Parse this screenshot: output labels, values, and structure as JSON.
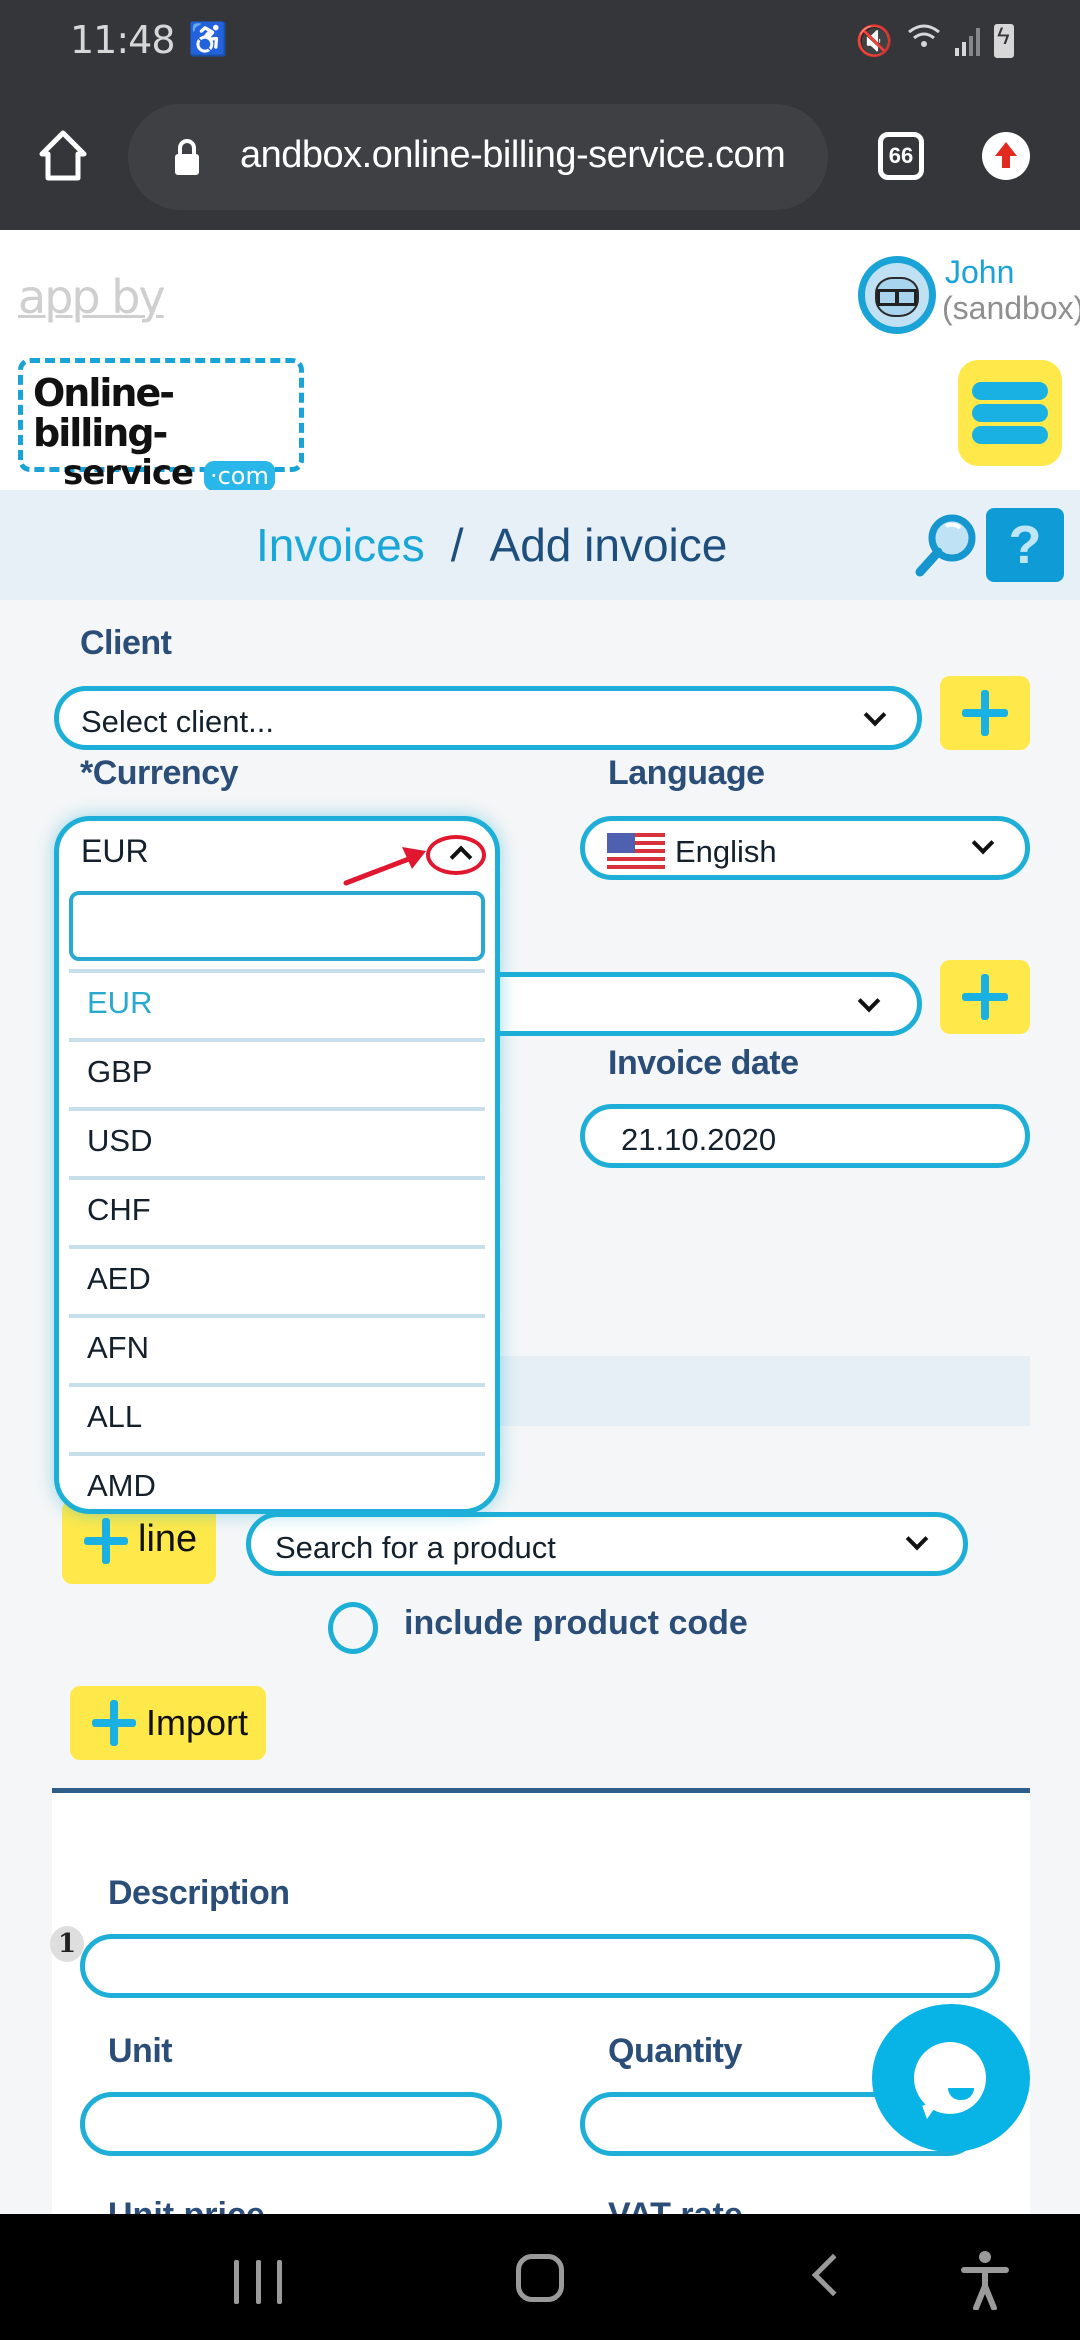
{
  "status_bar": {
    "time": "11:48",
    "notification_icon": "accessibility-notification-icon",
    "icons": [
      "mute-vibrate-icon",
      "wifi-icon",
      "signal-icon",
      "battery-charging-icon"
    ]
  },
  "browser": {
    "url": "andbox.online-billing-service.com",
    "tab_count": "66",
    "icons": [
      "home-icon",
      "lock-icon",
      "tabs-icon",
      "update-icon"
    ]
  },
  "header": {
    "app_by": "app by",
    "logo_line1": "Online-billing-",
    "logo_line2": "service",
    "logo_com": "·com",
    "user_name": "John",
    "user_sub": "(sandbox)"
  },
  "breadcrumb": {
    "parent": "Invoices",
    "separator": "/",
    "current": "Add invoice",
    "help_label": "?"
  },
  "form": {
    "client_label": "Client",
    "client_value": "Select client...",
    "currency_label": "Currency",
    "required_mark": "*",
    "language_label": "Language",
    "language_value": "English",
    "invoice_date_label": "Invoice date",
    "invoice_date_value": "21.10.2020"
  },
  "currency_dropdown": {
    "selected": "EUR",
    "search_value": "",
    "options": [
      "EUR",
      "GBP",
      "USD",
      "CHF",
      "AED",
      "AFN",
      "ALL",
      "AMD"
    ],
    "active_option": "EUR"
  },
  "lines": {
    "add_line_label": "line",
    "product_search_placeholder": "Search for a product",
    "include_code_label": "include product code",
    "import_label": "Import",
    "row_number": "1",
    "description_label": "Description",
    "unit_label": "Unit",
    "quantity_label": "Quantity",
    "unit_price_label": "Unit price",
    "vat_rate_label": "VAT rate"
  },
  "colors": {
    "accent": "#1eafd8",
    "button_yellow": "#ffe94a",
    "label_navy": "#2b4e78",
    "annotation_red": "#e0172f"
  }
}
